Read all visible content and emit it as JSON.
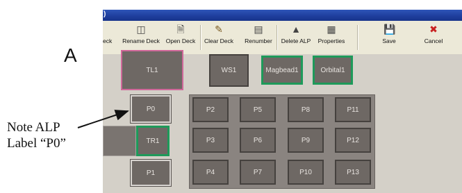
{
  "window": {
    "title_fragment": ")"
  },
  "toolbar": {
    "buttons": [
      {
        "label": "eck",
        "icon": "partial-icon"
      },
      {
        "label": "Rename Deck",
        "icon": "rename-deck-icon"
      },
      {
        "label": "Open Deck",
        "icon": "open-deck-icon"
      },
      {
        "label": "Clear Deck",
        "icon": "clear-deck-icon"
      },
      {
        "label": "Renumber",
        "icon": "renumber-icon"
      },
      {
        "label": "Delete ALP",
        "icon": "delete-alp-icon"
      },
      {
        "label": "Properties",
        "icon": "properties-icon"
      },
      {
        "label": "Save",
        "icon": "save-icon"
      },
      {
        "label": "Cancel",
        "icon": "cancel-icon"
      }
    ]
  },
  "deck": {
    "top_row": [
      "TL1",
      "WS1",
      "Magbead1",
      "Orbital1"
    ],
    "left_column": [
      "P0",
      "TR1",
      "P1"
    ],
    "grid": [
      [
        "P2",
        "P5",
        "P8",
        "P11"
      ],
      [
        "P3",
        "P6",
        "P9",
        "P12"
      ],
      [
        "P4",
        "P7",
        "P10",
        "P13"
      ]
    ]
  },
  "annotation": {
    "panel_label": "A",
    "note_line1": "Note ALP",
    "note_line2": "Label “P0”"
  },
  "colors": {
    "titlebar": "#1f3f9e",
    "slot": "#6e6864",
    "highlight_green": "#1e9a5a",
    "highlight_pink": "#d0689a"
  }
}
